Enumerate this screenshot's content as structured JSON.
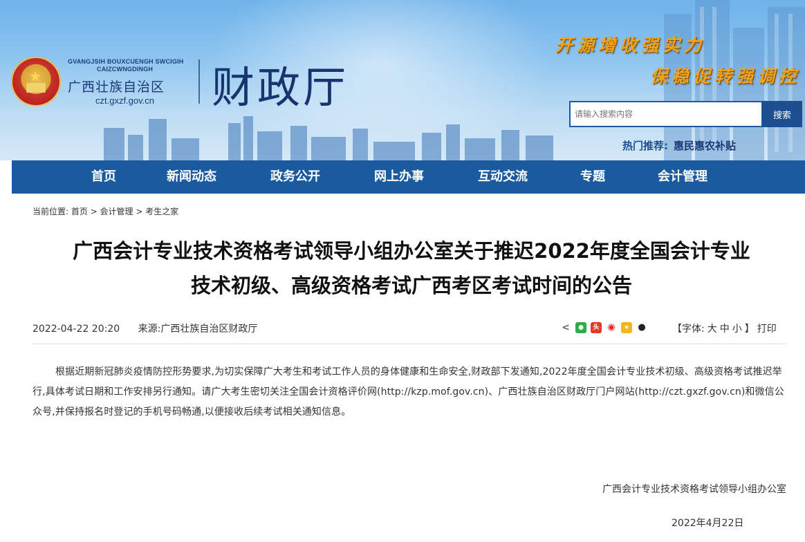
{
  "header": {
    "emblem_name": "national-emblem",
    "zhuang_line1": "GVANGJSIH BOUXCUENGH SWCIGIH",
    "zhuang_line2": "CAIZCWNGDINGH",
    "region": "广西壮族自治区",
    "domain": "czt.gxzf.gov.cn",
    "dept": "财政厅",
    "slogan1": "开源增收强实力",
    "slogan2": "保稳促转强调控",
    "search_placeholder": "请输入搜索内容",
    "search_button": "搜索",
    "hot_label": "热门推荐:",
    "hot_link": "惠民惠农补贴"
  },
  "nav": {
    "items": [
      "首页",
      "新闻动态",
      "政务公开",
      "网上办事",
      "互动交流",
      "专题",
      "会计管理"
    ]
  },
  "breadcrumb": {
    "label": "当前位置:",
    "path": "首页 > 会计管理 > 考生之家"
  },
  "article": {
    "title_line1": "广西会计专业技术资格考试领导小组办公室关于推迟2022年度全国会计专业",
    "title_line2": "技术初级、高级资格考试广西考区考试时间的公告",
    "datetime": "2022-04-22 20:20",
    "source": "来源:广西壮族自治区财政厅",
    "share_icons": [
      "share-icon",
      "wechat-icon",
      "toutiao-icon",
      "weibo-icon",
      "qzone-icon",
      "qq-icon"
    ],
    "font_label": "【字体:",
    "font_large": "大",
    "font_medium": "中",
    "font_small": "小",
    "font_close": "】",
    "print": "打印",
    "body": "根据近期新冠肺炎疫情防控形势要求,为切实保障广大考生和考试工作人员的身体健康和生命安全,财政部下发通知,2022年度全国会计专业技术初级、高级资格考试推迟举行,具体考试日期和工作安排另行通知。请广大考生密切关注全国会计资格评价网(http://kzp.mof.gov.cn)、广西壮族自治区财政厅门户网站(http://czt.gxzf.gov.cn)和微信公众号,并保持报名时登记的手机号码畅通,以便接收后续考试相关通知信息。",
    "signature": "广西会计专业技术资格考试领导小组办公室",
    "date": "2022年4月22日"
  },
  "colors": {
    "nav_bg": "#1a5a9e",
    "title": "#111111",
    "slogan": "#f2a21a",
    "brand": "#17346e"
  }
}
